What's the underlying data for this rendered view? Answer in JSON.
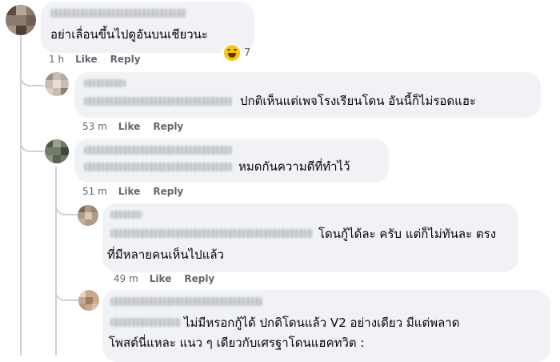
{
  "comments": [
    {
      "text_lines": [
        "อย่าเลื่อนขึ้นไปดูอันบนเชียวนะ"
      ],
      "time": "1 h",
      "like_label": "Like",
      "reply_label": "Reply",
      "reaction": {
        "icon": "laughing-emoji-icon",
        "count": "7"
      }
    },
    {
      "text_lines": [
        "ปกติเห็นแต่เพจโรงเรียนโดน อันนี้ก็ไม่รอดแฮะ"
      ],
      "time": "53 m",
      "like_label": "Like",
      "reply_label": "Reply"
    },
    {
      "text_lines": [
        "หมดกันความดีที่ทำไว้"
      ],
      "time": "51 m",
      "like_label": "Like",
      "reply_label": "Reply"
    },
    {
      "text_lines": [
        "โดนกู้ได้ละ ครับ แต่ก็ไม่ทันละ ตรง",
        "ที่มีหลายคนเห็นไปแล้ว"
      ],
      "time": "49 m",
      "like_label": "Like",
      "reply_label": "Reply"
    },
    {
      "text_lines": [
        "ไม่มีหรอกกู้ได้ ปกติโดนแล้ว V2 อย่างเดียว มีแต่พลาด",
        "โพสต์นี่แหละ แนว ๆ เดียวกับเศรฐาโดนแฮคทวิต :"
      ]
    }
  ],
  "colors": {
    "bubble": "#f0f2f5",
    "meta_text": "#65676b",
    "thread_line": "#ced0d4",
    "emoji": "#f7c51d"
  }
}
